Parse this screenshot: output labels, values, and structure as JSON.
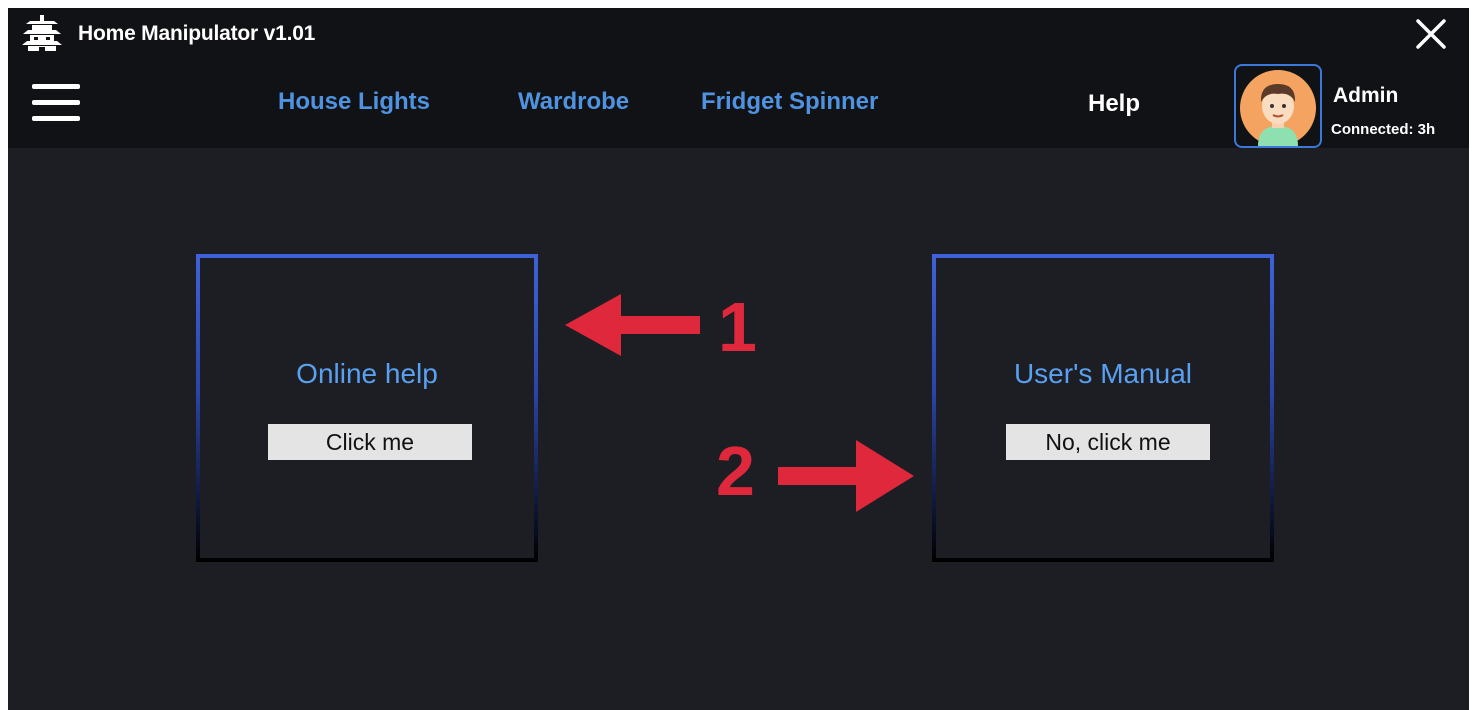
{
  "window": {
    "title": "Home Manipulator v1.01",
    "logo_icon": "pagoda-icon",
    "close_icon": "close-icon"
  },
  "nav": {
    "menu_icon": "hamburger-menu-icon",
    "items": [
      {
        "label": "House Lights"
      },
      {
        "label": "Wardrobe"
      },
      {
        "label": "Fridget Spinner"
      },
      {
        "label": "Help"
      }
    ],
    "link_color": "#4f93e0",
    "active_color": "#ffffff"
  },
  "user": {
    "name": "Admin",
    "status": "Connected: 3h"
  },
  "cards": [
    {
      "title": "Online help",
      "button_label": "Click me"
    },
    {
      "title": "User's Manual",
      "button_label": "No, click me"
    }
  ],
  "annotations": [
    {
      "number": "1",
      "arrow": "left-arrow-icon"
    },
    {
      "number": "2",
      "arrow": "right-arrow-icon"
    }
  ],
  "colors": {
    "background": "#1c1e24",
    "header": "#111215",
    "card_border": "#3e63d8",
    "title_text": "#5aa0f0",
    "annotation": "#e0283c"
  }
}
